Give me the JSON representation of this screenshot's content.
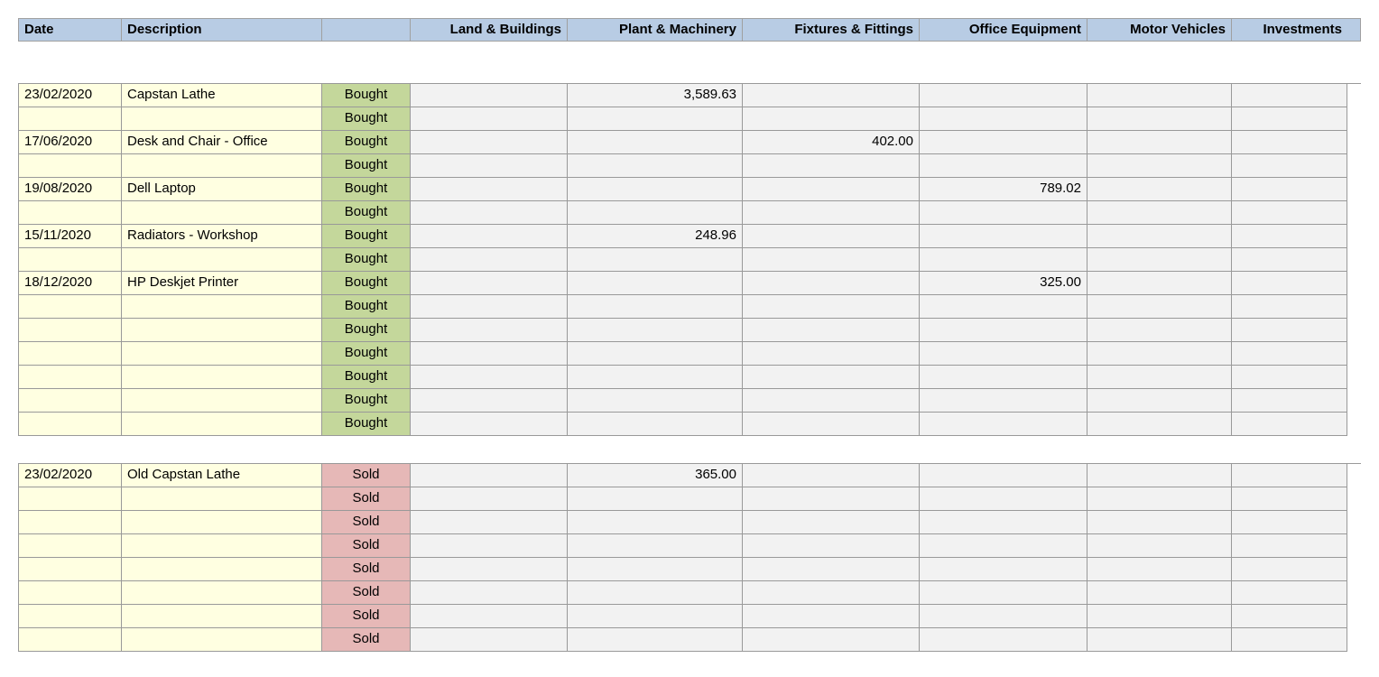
{
  "headers": {
    "date": "Date",
    "desc": "Description",
    "status": "",
    "land": "Land & Buildings",
    "plant": "Plant & Machinery",
    "fix": "Fixtures & Fittings",
    "off": "Office Equipment",
    "motor": "Motor Vehicles",
    "inv": "Investments"
  },
  "status_labels": {
    "bought": "Bought",
    "sold": "Sold"
  },
  "bought_rows": [
    {
      "date": "23/02/2020",
      "desc": "Capstan Lathe",
      "land": "",
      "plant": "3,589.63",
      "fix": "",
      "off": "",
      "motor": "",
      "inv": ""
    },
    {
      "date": "",
      "desc": "",
      "land": "",
      "plant": "",
      "fix": "",
      "off": "",
      "motor": "",
      "inv": ""
    },
    {
      "date": "17/06/2020",
      "desc": "Desk and Chair - Office",
      "land": "",
      "plant": "",
      "fix": "402.00",
      "off": "",
      "motor": "",
      "inv": ""
    },
    {
      "date": "",
      "desc": "",
      "land": "",
      "plant": "",
      "fix": "",
      "off": "",
      "motor": "",
      "inv": ""
    },
    {
      "date": "19/08/2020",
      "desc": "Dell Laptop",
      "land": "",
      "plant": "",
      "fix": "",
      "off": "789.02",
      "motor": "",
      "inv": ""
    },
    {
      "date": "",
      "desc": "",
      "land": "",
      "plant": "",
      "fix": "",
      "off": "",
      "motor": "",
      "inv": ""
    },
    {
      "date": "15/11/2020",
      "desc": "Radiators - Workshop",
      "land": "",
      "plant": "248.96",
      "fix": "",
      "off": "",
      "motor": "",
      "inv": ""
    },
    {
      "date": "",
      "desc": "",
      "land": "",
      "plant": "",
      "fix": "",
      "off": "",
      "motor": "",
      "inv": ""
    },
    {
      "date": "18/12/2020",
      "desc": "HP Deskjet Printer",
      "land": "",
      "plant": "",
      "fix": "",
      "off": "325.00",
      "motor": "",
      "inv": ""
    },
    {
      "date": "",
      "desc": "",
      "land": "",
      "plant": "",
      "fix": "",
      "off": "",
      "motor": "",
      "inv": ""
    },
    {
      "date": "",
      "desc": "",
      "land": "",
      "plant": "",
      "fix": "",
      "off": "",
      "motor": "",
      "inv": ""
    },
    {
      "date": "",
      "desc": "",
      "land": "",
      "plant": "",
      "fix": "",
      "off": "",
      "motor": "",
      "inv": ""
    },
    {
      "date": "",
      "desc": "",
      "land": "",
      "plant": "",
      "fix": "",
      "off": "",
      "motor": "",
      "inv": ""
    },
    {
      "date": "",
      "desc": "",
      "land": "",
      "plant": "",
      "fix": "",
      "off": "",
      "motor": "",
      "inv": ""
    },
    {
      "date": "",
      "desc": "",
      "land": "",
      "plant": "",
      "fix": "",
      "off": "",
      "motor": "",
      "inv": ""
    }
  ],
  "sold_rows": [
    {
      "date": "23/02/2020",
      "desc": "Old Capstan Lathe",
      "land": "",
      "plant": "365.00",
      "fix": "",
      "off": "",
      "motor": "",
      "inv": ""
    },
    {
      "date": "",
      "desc": "",
      "land": "",
      "plant": "",
      "fix": "",
      "off": "",
      "motor": "",
      "inv": ""
    },
    {
      "date": "",
      "desc": "",
      "land": "",
      "plant": "",
      "fix": "",
      "off": "",
      "motor": "",
      "inv": ""
    },
    {
      "date": "",
      "desc": "",
      "land": "",
      "plant": "",
      "fix": "",
      "off": "",
      "motor": "",
      "inv": ""
    },
    {
      "date": "",
      "desc": "",
      "land": "",
      "plant": "",
      "fix": "",
      "off": "",
      "motor": "",
      "inv": ""
    },
    {
      "date": "",
      "desc": "",
      "land": "",
      "plant": "",
      "fix": "",
      "off": "",
      "motor": "",
      "inv": ""
    },
    {
      "date": "",
      "desc": "",
      "land": "",
      "plant": "",
      "fix": "",
      "off": "",
      "motor": "",
      "inv": ""
    },
    {
      "date": "",
      "desc": "",
      "land": "",
      "plant": "",
      "fix": "",
      "off": "",
      "motor": "",
      "inv": ""
    }
  ]
}
